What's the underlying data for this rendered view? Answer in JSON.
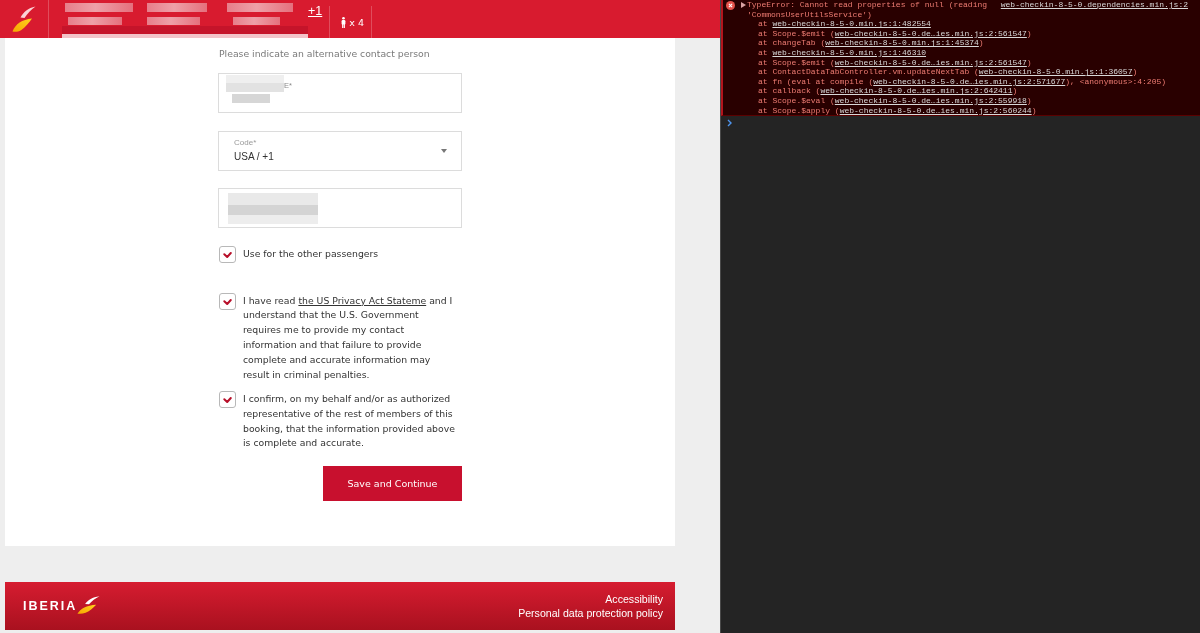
{
  "header": {
    "day_offset": "+1",
    "passengers": "x 4"
  },
  "form": {
    "title": "Please indicate an alternative contact person",
    "fields": [
      {
        "kind": "text",
        "label": "E*"
      },
      {
        "kind": "select",
        "label": "Code*",
        "value": "USA / +1"
      },
      {
        "kind": "text"
      }
    ],
    "share_option": {
      "label": "Use for the other passengers",
      "checked": true
    },
    "declarations": [
      {
        "checked": true,
        "text": "I have read",
        "link": "the US Privacy Act Stateme",
        "text_after": "and I understand that the U.S. Government requires me to provide my contact information and that failure to provide complete and accurate information may result in criminal penalties."
      },
      {
        "checked": true,
        "text": "I confirm, on my behalf and/or as authorized representative of the rest of members of this booking, that the information provided above is complete and accurate."
      }
    ],
    "submit_button": "Save and Continue"
  },
  "footer": {
    "brand": "IBERIA",
    "links": [
      "Accessibility",
      "Personal data protection policy"
    ]
  },
  "console": {
    "entries": [
      {
        "kind": "error",
        "expanded": false,
        "message": "TypeError: Cannot read properties of null (reading 'CommonsUserUtilsService')",
        "source": "web-checkin-8-5-0.dependencies.min.js:2",
        "stack": [
          {
            "prefix": "at ",
            "link": "web-checkin-8-5-0.min.js:1:482554"
          },
          {
            "prefix": "at Scope.$emit (",
            "link": "web-checkin-8-5-0.de…ies.min.js:2:561547",
            "suffix": ")"
          },
          {
            "prefix": "at changeTab (",
            "link": "web-checkin-8-5-0.min.js:1:45374",
            "suffix": ")"
          },
          {
            "prefix": "at ",
            "link": "web-checkin-8-5-0.min.js:1:46310"
          },
          {
            "prefix": "at Scope.$emit (",
            "link": "web-checkin-8-5-0.de…ies.min.js:2:561547",
            "suffix": ")"
          },
          {
            "prefix": "at ContactDataTabController.vm.updateNextTab (",
            "link": "web-checkin-8-5-0.min.js:1:36057",
            "suffix": ")"
          },
          {
            "prefix": "at fn (eval at compile (",
            "link": "web-checkin-8-5-0.de…ies.min.js:2:571677",
            "suffix": "), <anonymous>:4:205)"
          },
          {
            "prefix": "at callback (",
            "link": "web-checkin-8-5-0.de…ies.min.js:2:642411",
            "suffix": ")"
          },
          {
            "prefix": "at Scope.$eval (",
            "link": "web-checkin-8-5-0.de…ies.min.js:2:559918",
            "suffix": ")"
          },
          {
            "prefix": "at Scope.$apply (",
            "link": "web-checkin-8-5-0.de…ies.min.js:2:560244",
            "suffix": ")"
          }
        ]
      }
    ]
  }
}
